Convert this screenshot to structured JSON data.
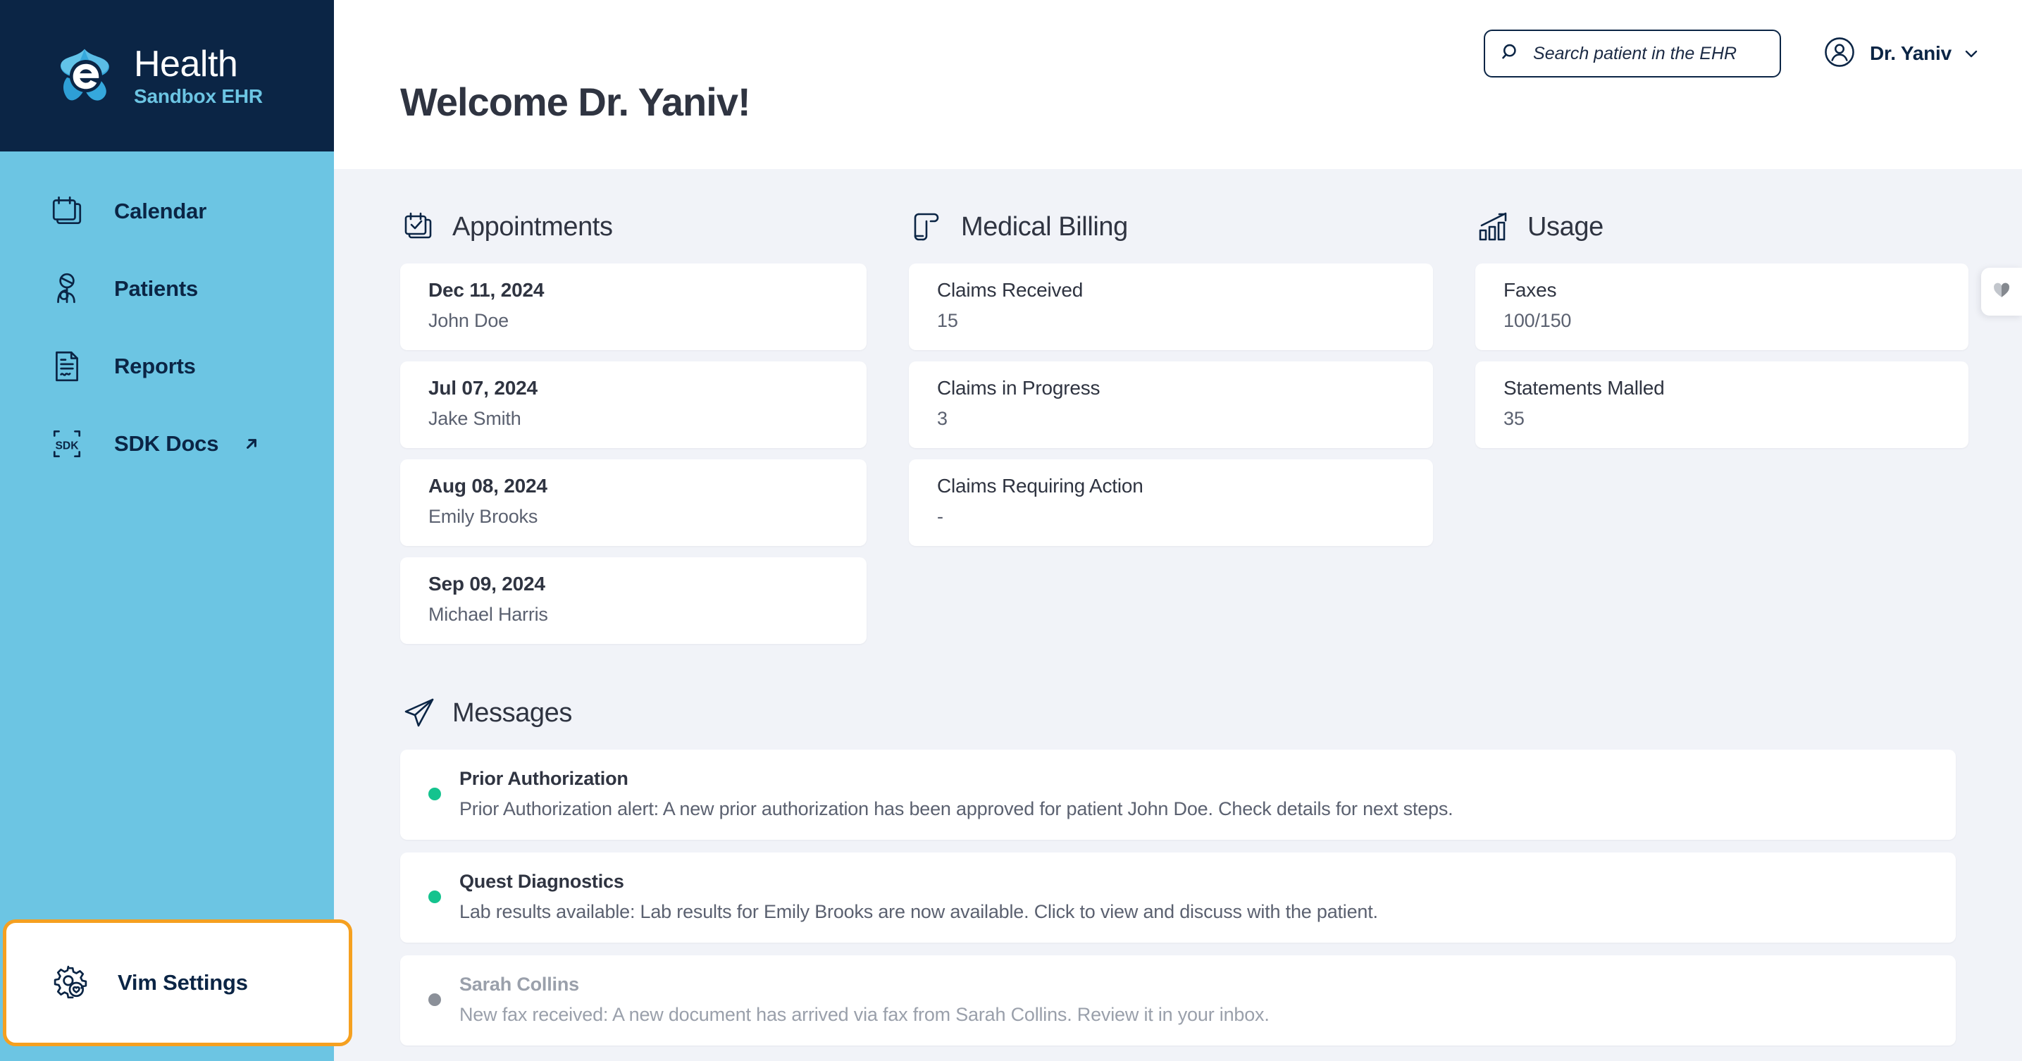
{
  "brand": {
    "name": "Health",
    "tagline": "Sandbox EHR",
    "logo_icon": "ehealth-logo-icon",
    "dark_color": "#0b2545",
    "accent_color": "#6cc5e3"
  },
  "sidebar": {
    "items": [
      {
        "label": "Calendar",
        "icon": "calendar-icon",
        "external": false
      },
      {
        "label": "Patients",
        "icon": "patient-icon",
        "external": false
      },
      {
        "label": "Reports",
        "icon": "report-document-icon",
        "external": false
      },
      {
        "label": "SDK Docs",
        "icon": "sdk-icon",
        "external": true,
        "external_icon": "external-link-arrow-icon"
      }
    ],
    "settings": {
      "label": "Vim Settings",
      "icon": "gear-heart-icon",
      "highlight_color": "#f5a020",
      "highlighted": true
    }
  },
  "topbar": {
    "search": {
      "placeholder": "Search patient in the EHR",
      "value": "",
      "icon": "search-icon"
    },
    "user": {
      "name": "Dr. Yaniv",
      "avatar_icon": "user-avatar-icon",
      "caret_icon": "chevron-down-icon"
    }
  },
  "page": {
    "heading": "Welcome Dr. Yaniv!",
    "background_color": "#f1f3f8"
  },
  "appointments": {
    "title": "Appointments",
    "icon": "calendar-check-icon",
    "items": [
      {
        "date": "Dec 11, 2024",
        "patient": "John Doe"
      },
      {
        "date": "Jul 07, 2024",
        "patient": "Jake Smith"
      },
      {
        "date": "Aug 08, 2024",
        "patient": "Emily Brooks"
      },
      {
        "date": "Sep 09, 2024",
        "patient": "Michael Harris"
      }
    ]
  },
  "medical_billing": {
    "title": "Medical Billing",
    "icon": "billing-scroll-icon",
    "items": [
      {
        "label": "Claims Received",
        "value": "15"
      },
      {
        "label": "Claims in Progress",
        "value": "3"
      },
      {
        "label": "Claims Requiring Action",
        "value": "-"
      }
    ]
  },
  "usage": {
    "title": "Usage",
    "icon": "usage-chart-icon",
    "items": [
      {
        "label": "Faxes",
        "value": "100/150"
      },
      {
        "label": "Statements Malled",
        "value": "35"
      }
    ]
  },
  "messages": {
    "title": "Messages",
    "icon": "paper-plane-icon",
    "unread_color": "#14c38e",
    "read_color": "#8b9099",
    "items": [
      {
        "sender": "Prior Authorization",
        "text": "Prior Authorization alert: A new prior authorization has been approved for patient John Doe. Check details for next steps.",
        "unread": true
      },
      {
        "sender": "Quest Diagnostics",
        "text": "Lab results available: Lab results for Emily Brooks are now available. Click to view and discuss with the patient.",
        "unread": true
      },
      {
        "sender": "Sarah Collins",
        "text": "New fax received: A new document has arrived via fax from Sarah Collins. Review it in your inbox.",
        "unread": false
      }
    ]
  },
  "favorites_tab": {
    "icon": "heart-icon"
  }
}
